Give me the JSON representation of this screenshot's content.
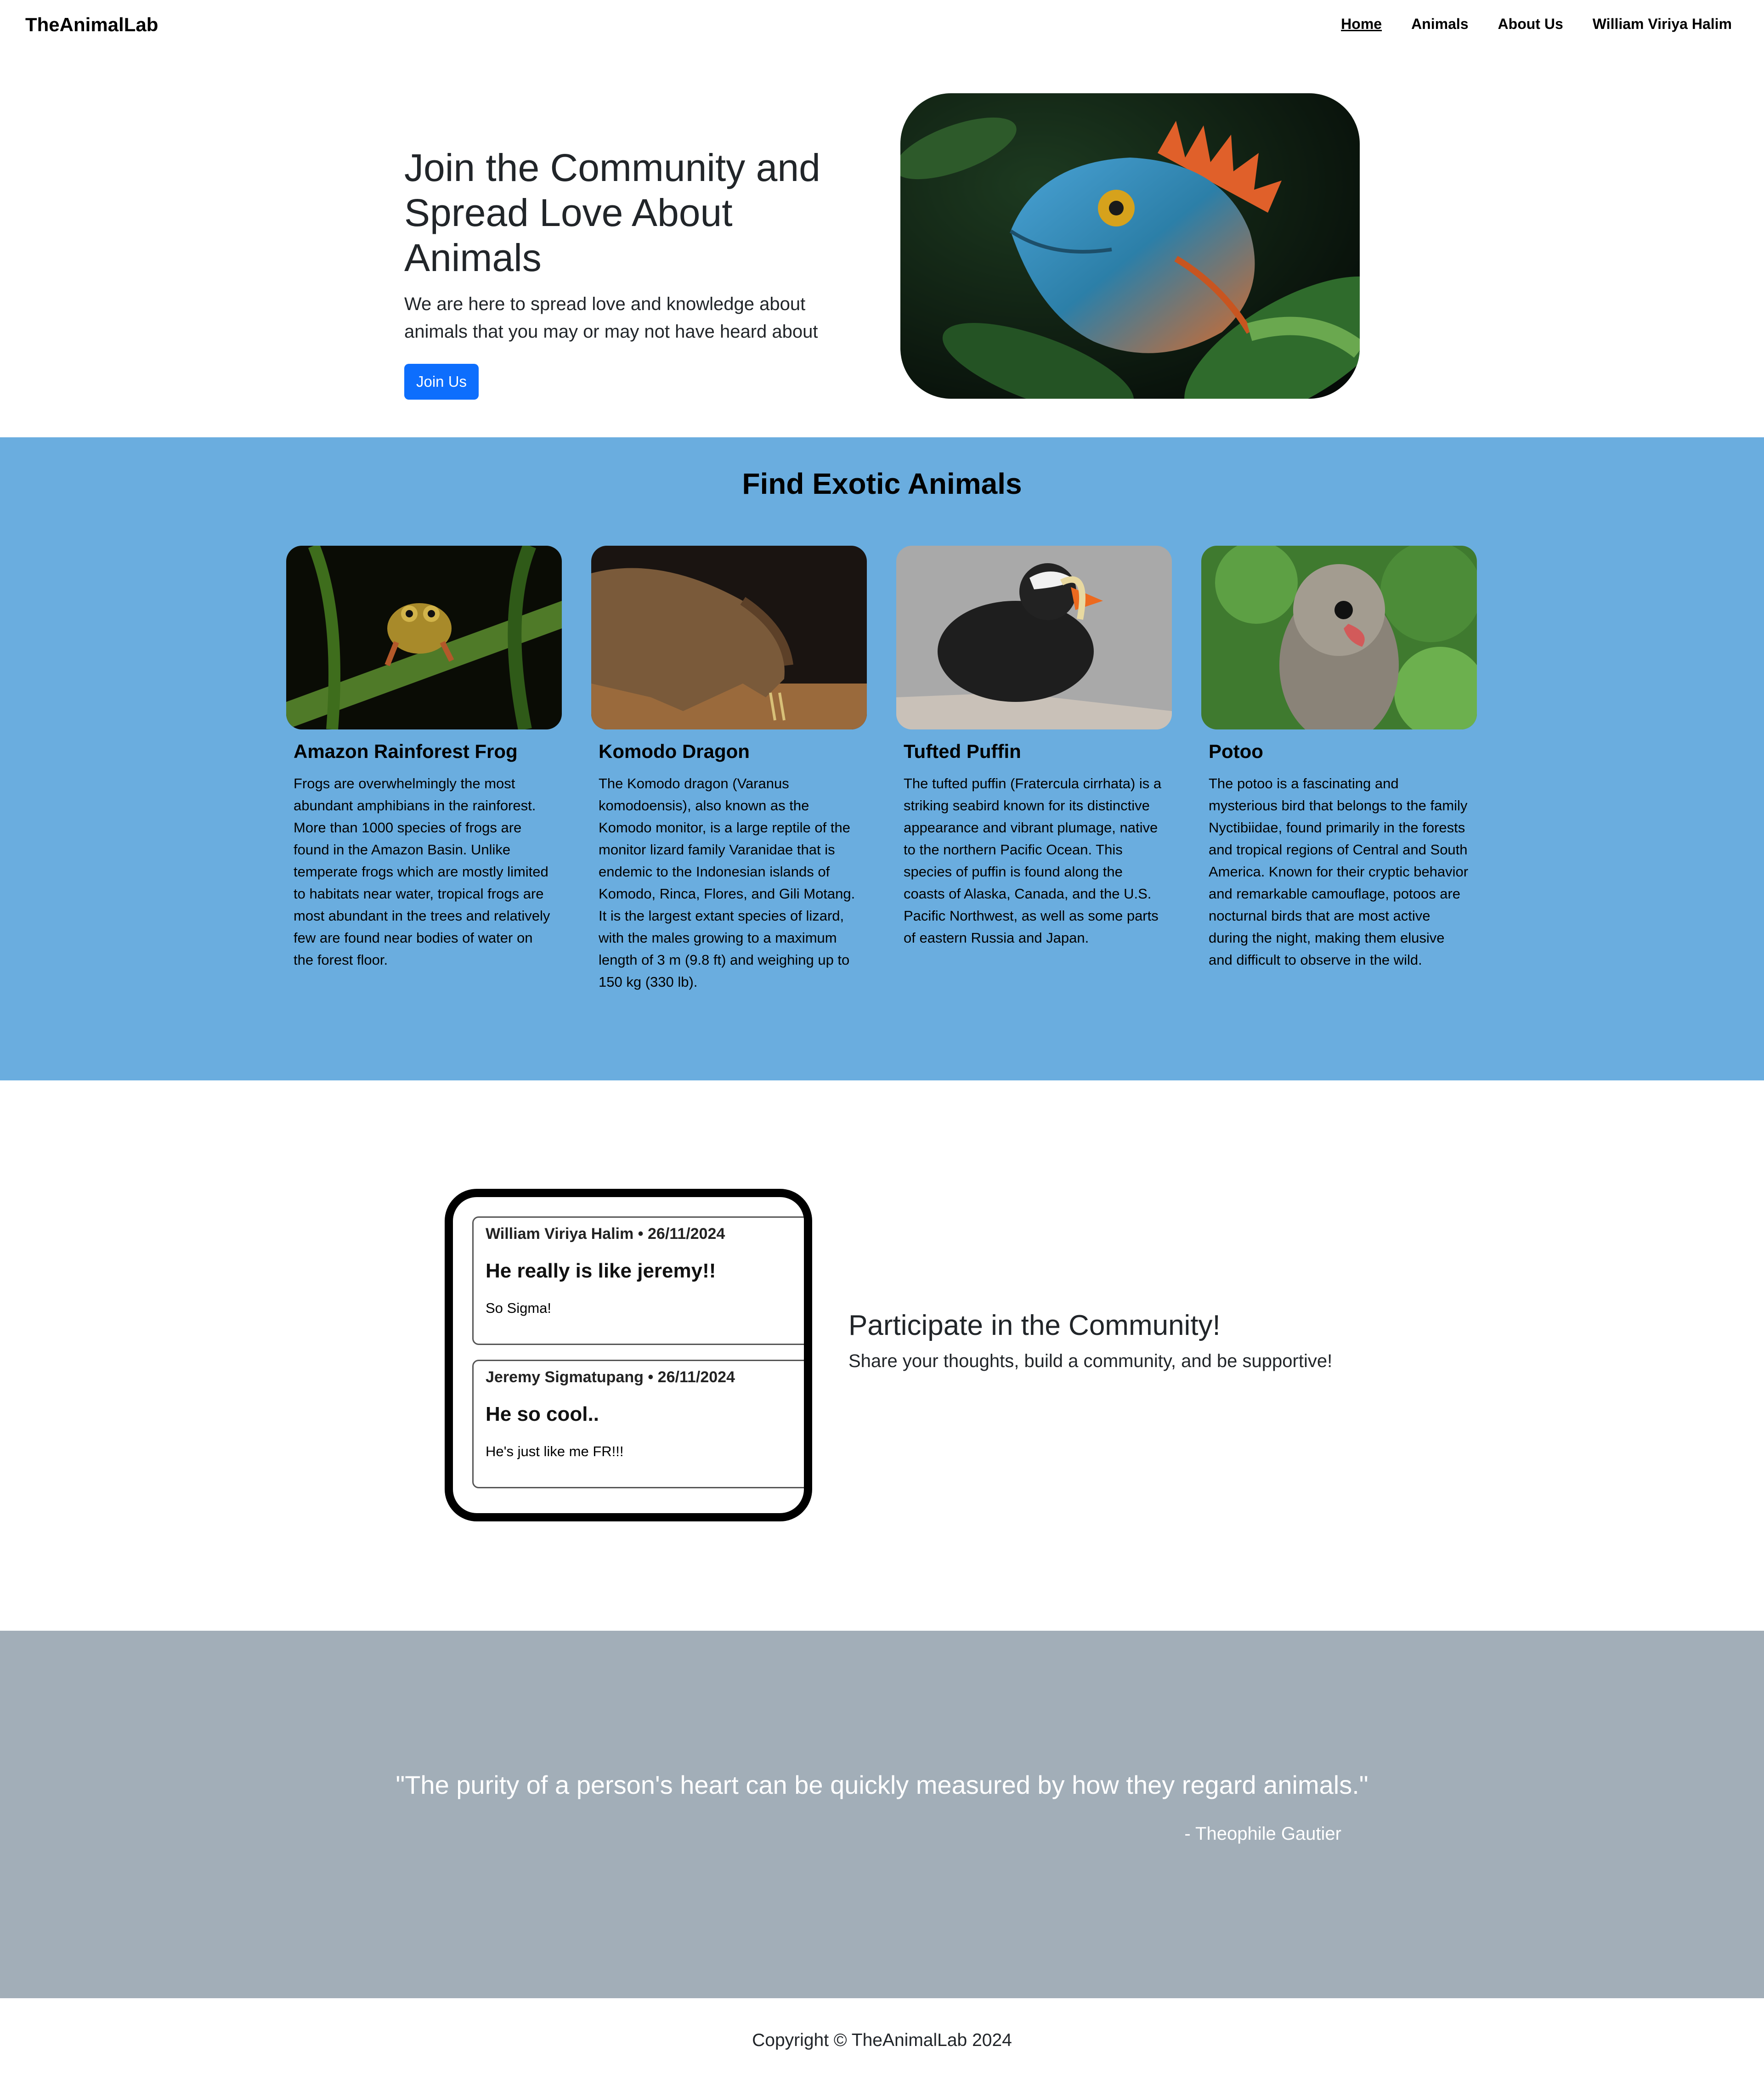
{
  "navbar": {
    "brand": "TheAnimalLab",
    "links": [
      {
        "label": "Home",
        "active": true
      },
      {
        "label": "Animals",
        "active": false
      },
      {
        "label": "About Us",
        "active": false
      },
      {
        "label": "William Viriya Halim",
        "active": false
      }
    ]
  },
  "hero": {
    "title": "Join the Community and Spread Love About Animals",
    "subtitle": "We are here to spread love and knowledge about animals that you may or may not have heard about",
    "button_label": "Join Us",
    "image_subject": "iguana"
  },
  "exotic": {
    "title": "Find Exotic Animals",
    "cards": [
      {
        "name": "Amazon Rainforest Frog",
        "image_subject": "frog",
        "description": "Frogs are overwhelmingly the most abundant amphibians in the rainforest. More than 1000 species of frogs are found in the Amazon Basin. Unlike temperate frogs which are mostly limited to habitats near water, tropical frogs are most abundant in the trees and relatively few are found near bodies of water on the forest floor."
      },
      {
        "name": "Komodo Dragon",
        "image_subject": "komodo-dragon",
        "description": "The Komodo dragon (Varanus komodoensis), also known as the Komodo monitor, is a large reptile of the monitor lizard family Varanidae that is endemic to the Indonesian islands of Komodo, Rinca, Flores, and Gili Motang. It is the largest extant species of lizard, with the males growing to a maximum length of 3 m (9.8 ft) and weighing up to 150 kg (330 lb)."
      },
      {
        "name": "Tufted Puffin",
        "image_subject": "puffin",
        "description": "The tufted puffin (Fratercula cirrhata) is a striking seabird known for its distinctive appearance and vibrant plumage, native to the northern Pacific Ocean. This species of puffin is found along the coasts of Alaska, Canada, and the U.S. Pacific Northwest, as well as some parts of eastern Russia and Japan."
      },
      {
        "name": "Potoo",
        "image_subject": "potoo",
        "description": "The potoo is a fascinating and mysterious bird that belongs to the family Nyctibiidae, found primarily in the forests and tropical regions of Central and South America. Known for their cryptic behavior and remarkable camouflage, potoos are nocturnal birds that are most active during the night, making them elusive and difficult to observe in the wild."
      }
    ]
  },
  "community": {
    "posts": [
      {
        "meta": "William Viriya Halim • 26/11/2024",
        "title": "He really is like jeremy!!",
        "body": "So Sigma!"
      },
      {
        "meta": "Jeremy Sigmatupang • 26/11/2024",
        "title": "He so cool..",
        "body": "He's just like me FR!!!"
      }
    ],
    "title": "Participate in the Community!",
    "subtitle": "Share your thoughts, build a community, and be supportive!"
  },
  "quote": {
    "text": "\"The purity of a person's heart can be quickly measured by how they regard animals.\"",
    "author": "- Theophile Gautier"
  },
  "footer": {
    "text": "Copyright © TheAnimalLab 2024"
  },
  "colors": {
    "primary_button": "#0d6efd",
    "exotic_bg": "#6aaddf",
    "quote_bg": "#a2aeb8"
  }
}
